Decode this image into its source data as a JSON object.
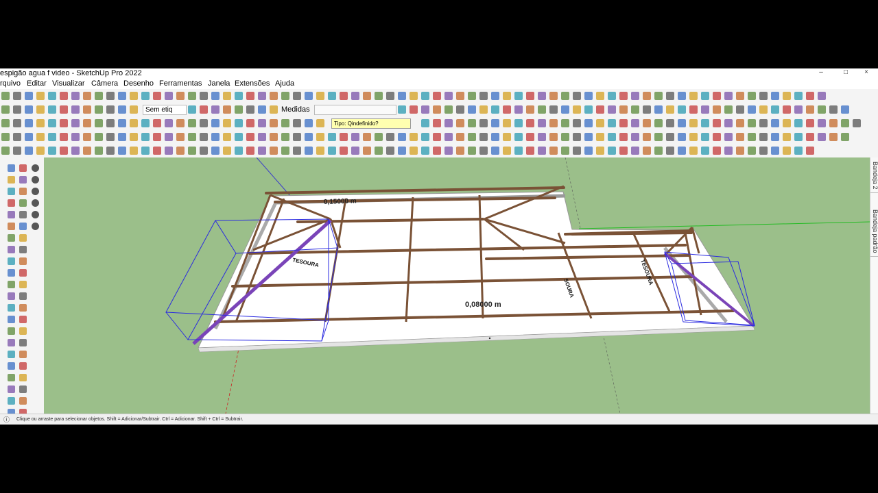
{
  "window": {
    "title": "espigão agua f video - SketchUp Pro 2022",
    "minimize_glyph": "–",
    "maximize_glyph": "□",
    "close_glyph": "×"
  },
  "menu": [
    "rquivo",
    "Editar",
    "Visualizar",
    "Câmera",
    "Desenho",
    "Ferramentas",
    "Janela",
    "Extensões",
    "Ajuda"
  ],
  "toolbar": {
    "tag_selector": "Sem etiq",
    "measurements_label": "Medidas",
    "type_field": "Tipo: Qindefinido?"
  },
  "viewport": {
    "dimension_top": "0,15000 m",
    "dimension_center": "0,08000 m",
    "truss_labels": [
      "TESOURA",
      "SOURA",
      "TESOURA"
    ]
  },
  "right_panel": {
    "tab1": "Bandeja 2",
    "tab2": "Bandeja padrão"
  },
  "status": {
    "hint": "Clique ou arraste para selecionar objetos. Shift = Adicionar/Subtrair. Ctrl = Adicionar. Shift + Ctrl = Subtrair."
  },
  "colors": {
    "viewport_bg": "#9bbf8a",
    "timber": "#7a5236",
    "selection_blue": "#2a2ae0",
    "hip_purple": "#7a44b8"
  }
}
